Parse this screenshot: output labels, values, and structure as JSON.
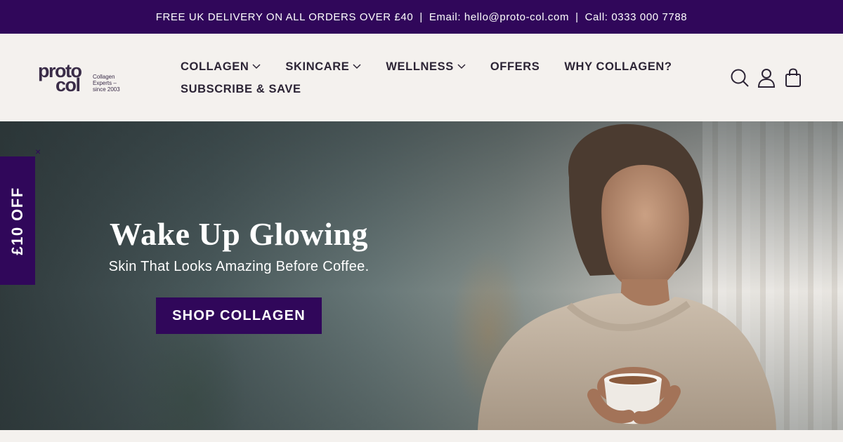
{
  "announcement": {
    "delivery": "FREE UK DELIVERY ON ALL ORDERS OVER £40",
    "separator": "|",
    "email": "Email: hello@proto-col.com",
    "phone": "Call: 0333 000 7788"
  },
  "logo": {
    "line1": "proto",
    "line2": "col",
    "tagline": [
      "Collagen",
      "Experts –",
      "since 2003"
    ]
  },
  "nav": {
    "row1": [
      {
        "label": "COLLAGEN",
        "has_dropdown": true
      },
      {
        "label": "SKINCARE",
        "has_dropdown": true
      },
      {
        "label": "WELLNESS",
        "has_dropdown": true
      },
      {
        "label": "OFFERS",
        "has_dropdown": false
      },
      {
        "label": "WHY COLLAGEN?",
        "has_dropdown": false
      }
    ],
    "row2": [
      {
        "label": "SUBSCRIBE & SAVE",
        "has_dropdown": false
      }
    ]
  },
  "header_icons": [
    "search-icon",
    "account-icon",
    "cart-icon"
  ],
  "hero": {
    "title": "Wake Up Glowing",
    "subtitle": "Skin That Looks Amazing Before Coffee.",
    "cta": "SHOP COLLAGEN"
  },
  "promo": {
    "label": "£10 OFF",
    "close": "×"
  },
  "colors": {
    "brand_purple": "#30075a",
    "text_dark": "#2c2435",
    "background": "#f4f1ee"
  }
}
